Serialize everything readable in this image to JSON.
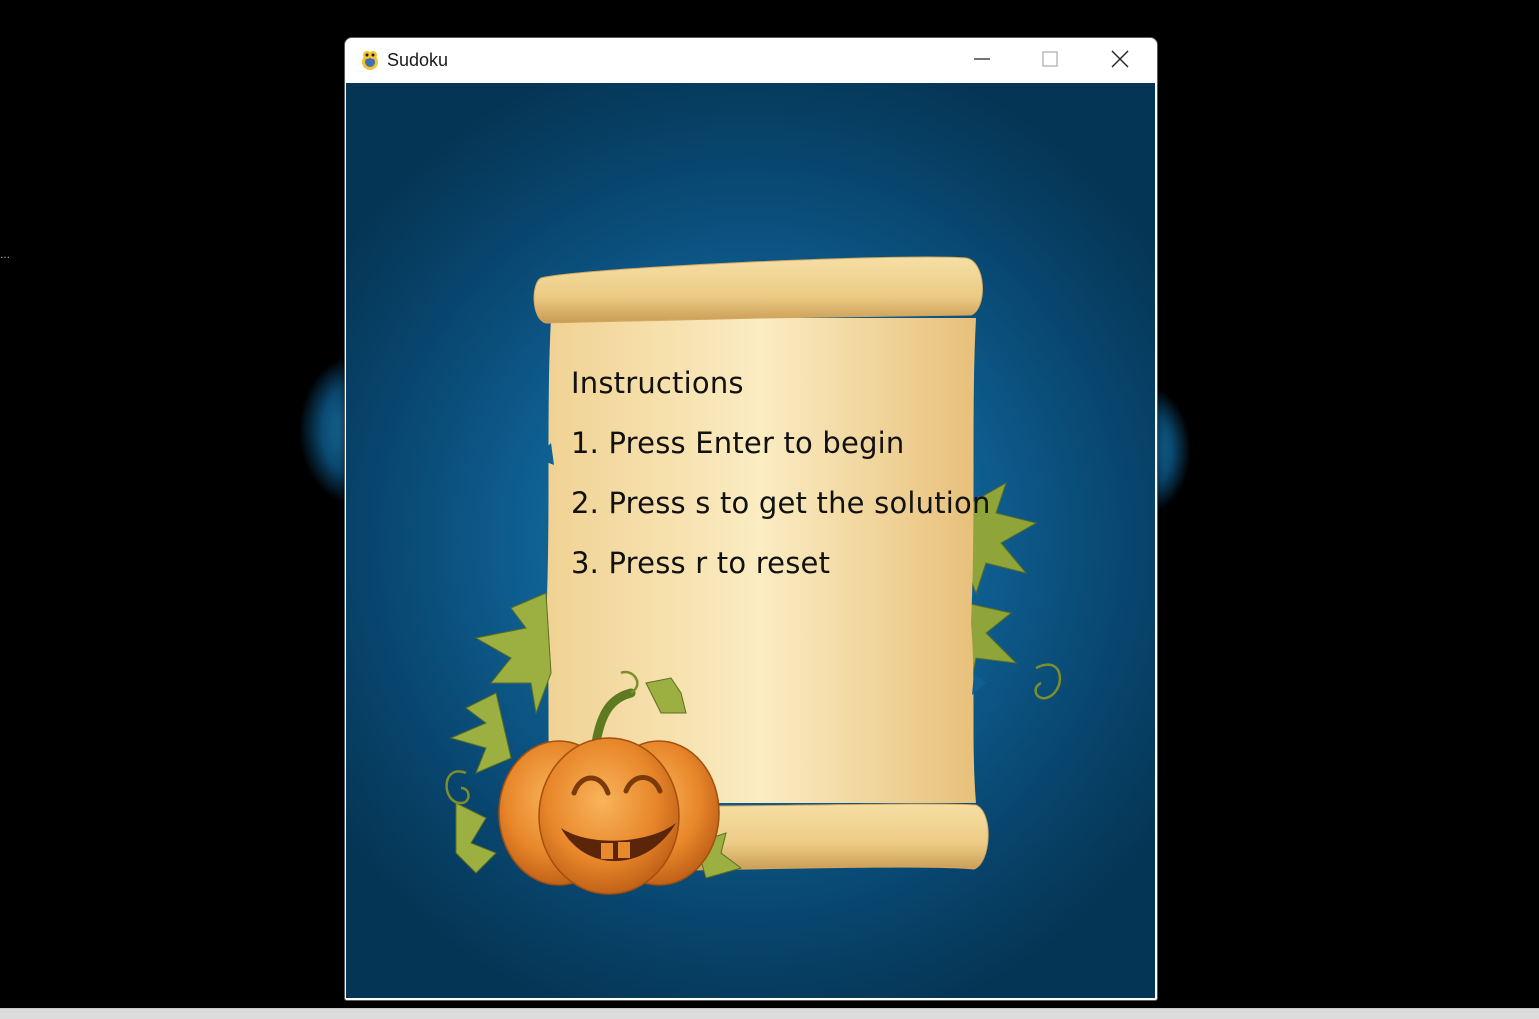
{
  "window": {
    "title": "Sudoku"
  },
  "instructions": {
    "heading": "Instructions",
    "steps": [
      "1. Press Enter to begin",
      "2. Press s to get the solution",
      "3. Press r to reset"
    ]
  },
  "colors": {
    "background_blue": "#0f5f92",
    "parchment": "#f5dfa6",
    "pumpkin": "#e88a2c",
    "leaf": "#8fa53a"
  },
  "icons": {
    "app": "pygame-snake-icon",
    "minimize": "minimize-icon",
    "maximize": "maximize-icon",
    "close": "close-icon"
  }
}
